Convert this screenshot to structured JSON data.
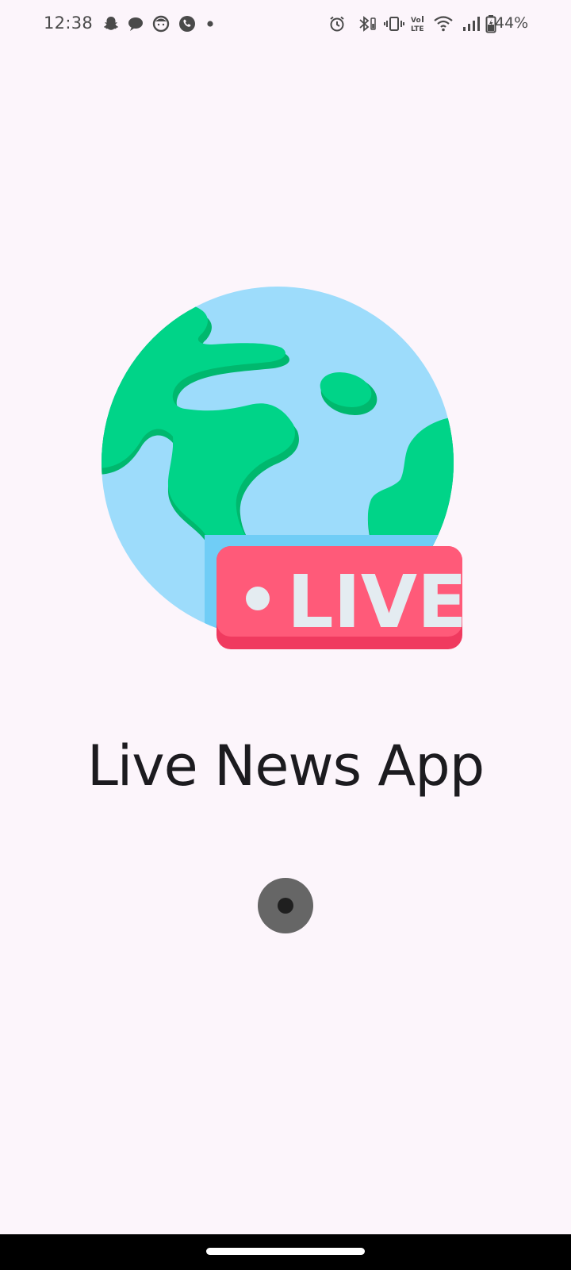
{
  "status_bar": {
    "time": "12:38",
    "battery": "44%",
    "left_icons": [
      "snapchat-icon",
      "chat-bubble-icon",
      "face-app-icon",
      "phone-app-icon",
      "notification-dot-icon"
    ],
    "right_icons": [
      "alarm-icon",
      "bluetooth-icon",
      "vibrate-icon",
      "volte-icon",
      "wifi-icon",
      "signal-icon",
      "battery-icon"
    ]
  },
  "splash": {
    "logo_badge_text": "LIVE",
    "title": "Live News App",
    "colors": {
      "globe_ocean": "#9ddcfb",
      "globe_land": "#00d488",
      "badge": "#ff5a79",
      "badge_text": "#e4ecf1",
      "background": "#fcf5fb"
    }
  },
  "nav_bar": {
    "handle": "home-gesture-handle"
  }
}
